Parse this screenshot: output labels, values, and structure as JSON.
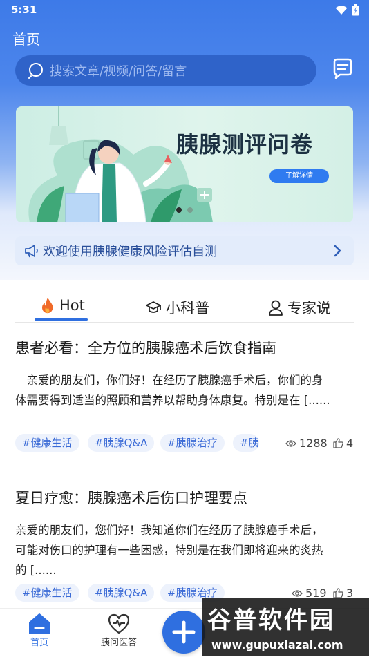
{
  "status_bar": {
    "time": "5:31"
  },
  "header": {
    "title": "首页",
    "search_placeholder": "搜索文章/视频/问答/留言"
  },
  "banner": {
    "title": "胰腺测评问卷",
    "button_label": "了解详情"
  },
  "notice": {
    "text": "欢迎使用胰腺健康风险评估自测"
  },
  "tabs": [
    {
      "label": "Hot",
      "icon": "flame-icon",
      "active": true
    },
    {
      "label": "小科普",
      "icon": "graduation-cap-icon",
      "active": false
    },
    {
      "label": "专家说",
      "icon": "person-icon",
      "active": false
    }
  ],
  "articles": [
    {
      "title": "患者必看：全方位的胰腺癌术后饮食指南",
      "excerpt": "　亲爱的朋友们，你们好！在经历了胰腺癌手术后，你们的身体需要得到适当的照顾和营养以帮助身体康复。特别是在 [......",
      "tags": [
        "#健康生活",
        "#胰腺Q&A",
        "#胰腺治疗",
        "#胰"
      ],
      "views": "1288",
      "likes": "4"
    },
    {
      "title": "夏日疗愈：胰腺癌术后伤口护理要点",
      "excerpt": "亲爱的朋友们，您们好！我知道你们在经历了胰腺癌手术后，可能对伤口的护理有一些困惑，特别是在我们即将迎来的炎热的 [......",
      "tags": [
        "#健康生活",
        "#胰腺Q&A",
        "#胰腺治疗"
      ],
      "views": "519",
      "likes": "3"
    }
  ],
  "bottom_nav": [
    {
      "label": "首页",
      "icon": "home-icon",
      "active": true
    },
    {
      "label": "胰问医答",
      "icon": "heart-pulse-icon",
      "active": false
    }
  ],
  "watermark": {
    "line1": "谷普软件园",
    "line2": "www.gupuxiazai.com"
  },
  "colors": {
    "accent": "#2f6fe0",
    "header_bg": "#3d7ae8",
    "tag_bg": "#edf2fc"
  }
}
